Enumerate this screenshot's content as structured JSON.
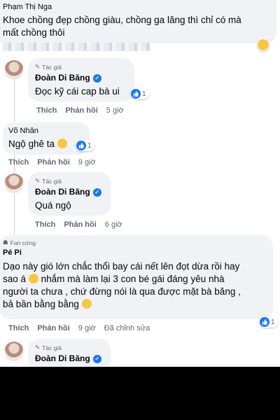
{
  "comments": [
    {
      "author": "Phạm Thị Nga",
      "text_lines": [
        "Khoe chồng đẹp chồng giàu, chồng ga lăng thì chỉ có mà",
        "mất chồng thôi"
      ]
    },
    {
      "badge": "Tác giả",
      "author": "Đoàn Di Băng",
      "text": "Đọc kỹ cái cap bà ui",
      "reaction_count": "1",
      "actions": {
        "like": "Thích",
        "reply": "Phản hồi",
        "time": "5 giờ"
      }
    },
    {
      "author": "Võ Nhân",
      "text": "Ngộ ghê ta",
      "reaction_count": "1",
      "actions": {
        "like": "Thích",
        "reply": "Phản hồi",
        "time": "9 giờ"
      }
    },
    {
      "badge": "Tác giả",
      "author": "Đoàn Di Băng",
      "text": "Quá ngộ",
      "actions": {
        "like": "Thích",
        "reply": "Phản hồi",
        "time": "6 giờ"
      }
    },
    {
      "badge": "Fan cứng",
      "author": "Pé Pi",
      "text_lines": [
        "Dạo này gió lớn chắc thổi bay cái nết lên đọt dừa rồi hay",
        "sao á",
        "nhắm mà làm lại 3 con bé gái đáng yêu nhà",
        "người ta chưa , chứ đừng nói là qua được mặt bà băng ,",
        "bả bần bằng bằng"
      ],
      "reaction_count": "1",
      "actions": {
        "like": "Thích",
        "reply": "Phản hồi",
        "time": "9 giờ",
        "edited": "Đã chỉnh sửa"
      }
    },
    {
      "badge": "Tác giả",
      "author": "Đoàn Di Băng"
    }
  ],
  "colors": {
    "bubble": "#f0f2f5",
    "muted": "#65676b",
    "verified": "#1877f2",
    "like": "#1877f2"
  }
}
